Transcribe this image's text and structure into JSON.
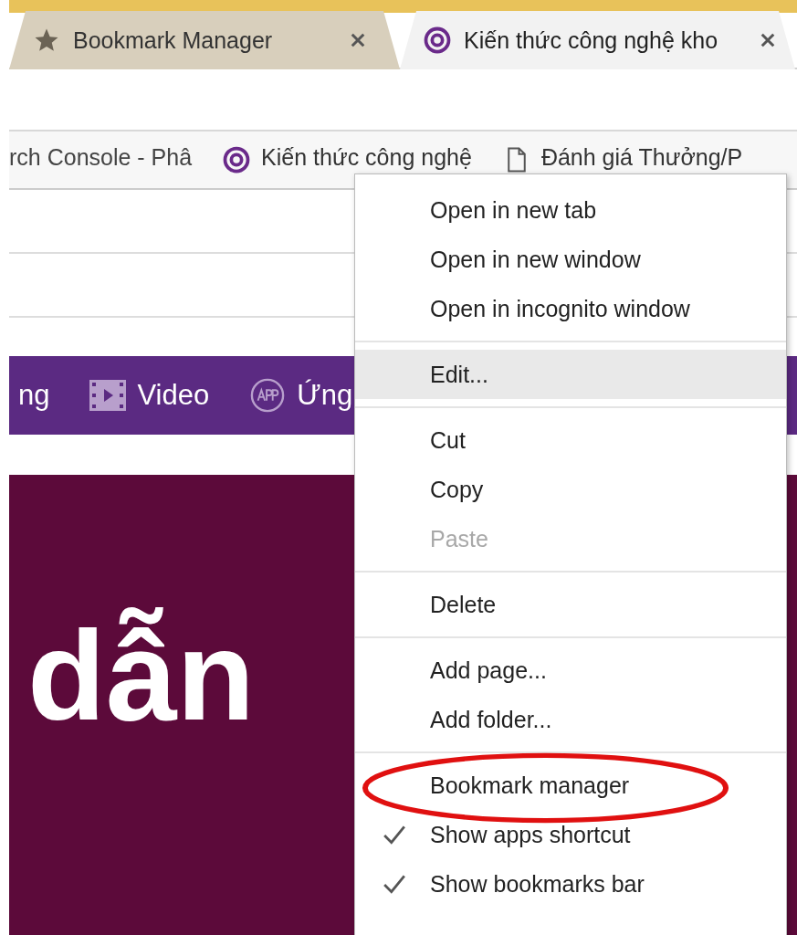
{
  "tabs": [
    {
      "title": "Bookmark Manager",
      "selected": false
    },
    {
      "title": "Kiến thức công nghệ kho",
      "selected": true
    }
  ],
  "bookmarks_bar": [
    {
      "label": "rch Console - Phâ"
    },
    {
      "label": "Kiến thức công nghệ"
    },
    {
      "label": "Đánh giá Thưởng/P"
    }
  ],
  "site_nav": [
    {
      "label": "ng"
    },
    {
      "label": "Video"
    },
    {
      "label": "Ứng"
    }
  ],
  "hero": {
    "heading": "dẫn"
  },
  "context_menu": {
    "groups": [
      [
        {
          "label": "Open in new tab",
          "selected": false,
          "disabled": false,
          "checked": false,
          "circled": false
        },
        {
          "label": "Open in new window",
          "selected": false,
          "disabled": false,
          "checked": false,
          "circled": false
        },
        {
          "label": "Open in incognito window",
          "selected": false,
          "disabled": false,
          "checked": false,
          "circled": false
        }
      ],
      [
        {
          "label": "Edit...",
          "selected": true,
          "disabled": false,
          "checked": false,
          "circled": false
        }
      ],
      [
        {
          "label": "Cut",
          "selected": false,
          "disabled": false,
          "checked": false,
          "circled": false
        },
        {
          "label": "Copy",
          "selected": false,
          "disabled": false,
          "checked": false,
          "circled": false
        },
        {
          "label": "Paste",
          "selected": false,
          "disabled": true,
          "checked": false,
          "circled": false
        }
      ],
      [
        {
          "label": "Delete",
          "selected": false,
          "disabled": false,
          "checked": false,
          "circled": false
        }
      ],
      [
        {
          "label": "Add page...",
          "selected": false,
          "disabled": false,
          "checked": false,
          "circled": false
        },
        {
          "label": "Add folder...",
          "selected": false,
          "disabled": false,
          "checked": false,
          "circled": false
        }
      ],
      [
        {
          "label": "Bookmark manager",
          "selected": false,
          "disabled": false,
          "checked": false,
          "circled": true
        },
        {
          "label": "Show apps shortcut",
          "selected": false,
          "disabled": false,
          "checked": true,
          "circled": false
        },
        {
          "label": "Show bookmarks bar",
          "selected": false,
          "disabled": false,
          "checked": true,
          "circled": false
        }
      ]
    ]
  }
}
